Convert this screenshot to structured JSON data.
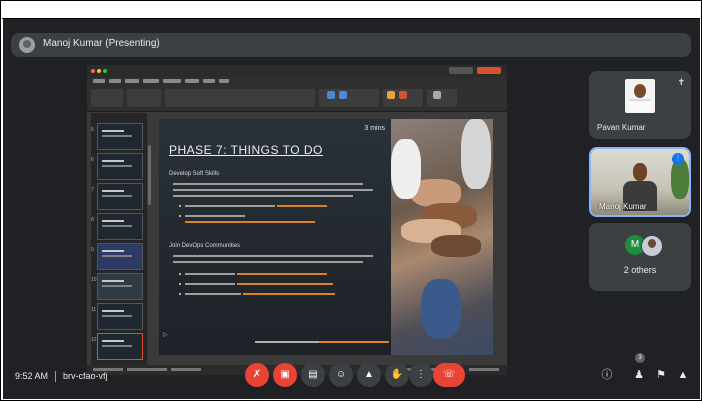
{
  "meeting": {
    "presenter_label": "Manoj Kumar (Presenting)",
    "time": "9:52 AM",
    "meeting_code": "brv-cfao-vfj"
  },
  "slide": {
    "minutes_label": "3 mins",
    "title": "PHASE 7: THINGS TO DO",
    "section_1": "Develop Soft Skills",
    "section_2": "Join DevOps Communities"
  },
  "participants": [
    {
      "name": "Pavan Kumar"
    },
    {
      "name": "Manoj Kumar"
    }
  ],
  "others_label": "2 others",
  "others_initial": "M",
  "people_count": "3",
  "icons": {
    "mic": "mic-off-icon",
    "camera": "camera-off-icon",
    "captions": "captions-icon",
    "emoji": "emoji-icon",
    "present": "present-icon",
    "hand": "raise-hand-icon",
    "more": "more-options-icon",
    "end": "end-call-icon"
  },
  "colors": {
    "background": "#202124",
    "tile": "#3c4043",
    "danger": "#ea4335",
    "active_border": "#8ab4f8",
    "accent_orange": "#d35230"
  }
}
